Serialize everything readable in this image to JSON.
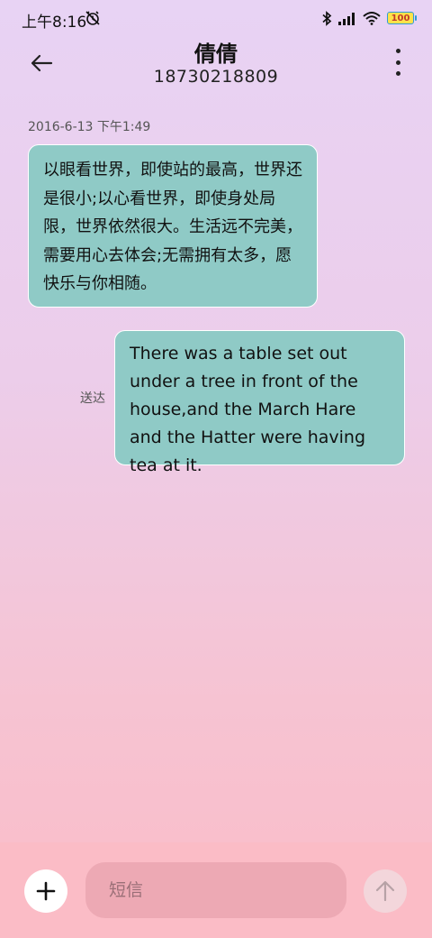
{
  "status_bar": {
    "time": "上午8:16",
    "battery_level": "100",
    "icons": [
      "alarm-off-icon",
      "bluetooth-icon",
      "signal-icon",
      "wifi-icon",
      "battery-icon"
    ]
  },
  "header": {
    "contact_name": "倩倩",
    "contact_number": "18730218809",
    "icons": [
      "back-arrow-icon",
      "more-vert-icon"
    ]
  },
  "conversation": {
    "timestamp": "2016-6-13 下午1:49",
    "messages": [
      {
        "direction": "received",
        "text": "以眼看世界，即使站的最高，世界还是很小;以心看世界，即使身处局限，世界依然很大。生活远不完美，需要用心去体会;无需拥有太多，愿快乐与你相随。"
      },
      {
        "direction": "sent",
        "text": "There was a table set out under a tree in front of the house,and the March Hare and the Hatter were having tea at it.",
        "status": "送达"
      }
    ]
  },
  "composer": {
    "placeholder": "短信",
    "value": "",
    "icons": [
      "plus-icon",
      "send-arrow-icon"
    ]
  },
  "colors": {
    "bubble": "#8fcac6",
    "bubble_border": "#ffffff",
    "composer_bg": "#fbbcc6",
    "input_bg": "#eda9b4"
  }
}
